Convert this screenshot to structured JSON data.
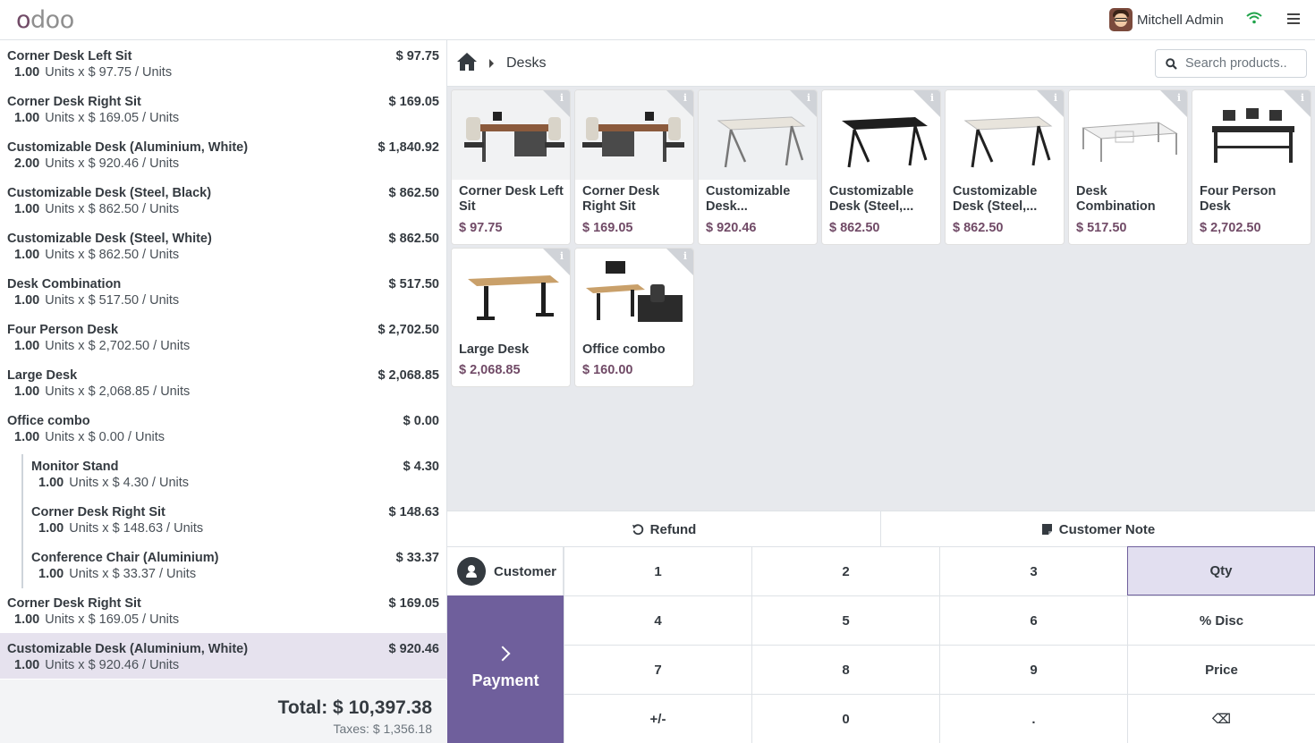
{
  "app": {
    "logo_text": "odoo"
  },
  "header": {
    "user_name": "Mitchell Admin",
    "wifi_icon": "wifi-icon",
    "menu_icon": "hamburger-menu-icon"
  },
  "order": {
    "lines": [
      {
        "name": "Corner Desk Left Sit",
        "price": "$ 97.75",
        "qty": "1.00",
        "detail": "Units x $ 97.75 / Units"
      },
      {
        "name": "Corner Desk Right Sit",
        "price": "$ 169.05",
        "qty": "1.00",
        "detail": "Units x $ 169.05 / Units"
      },
      {
        "name": "Customizable Desk (Aluminium, White)",
        "price": "$ 1,840.92",
        "qty": "2.00",
        "detail": "Units x $ 920.46 / Units"
      },
      {
        "name": "Customizable Desk (Steel, Black)",
        "price": "$ 862.50",
        "qty": "1.00",
        "detail": "Units x $ 862.50 / Units"
      },
      {
        "name": "Customizable Desk (Steel, White)",
        "price": "$ 862.50",
        "qty": "1.00",
        "detail": "Units x $ 862.50 / Units"
      },
      {
        "name": "Desk Combination",
        "price": "$ 517.50",
        "qty": "1.00",
        "detail": "Units x $ 517.50 / Units"
      },
      {
        "name": "Four Person Desk",
        "price": "$ 2,702.50",
        "qty": "1.00",
        "detail": "Units x $ 2,702.50 / Units"
      },
      {
        "name": "Large Desk",
        "price": "$ 2,068.85",
        "qty": "1.00",
        "detail": "Units x $ 2,068.85 / Units"
      },
      {
        "name": "Office combo",
        "price": "$ 0.00",
        "qty": "1.00",
        "detail": "Units x $ 0.00 / Units"
      },
      {
        "name": "Monitor Stand",
        "price": "$ 4.30",
        "qty": "1.00",
        "detail": "Units x $ 4.30 / Units"
      },
      {
        "name": "Corner Desk Right Sit",
        "price": "$ 148.63",
        "qty": "1.00",
        "detail": "Units x $ 148.63 / Units"
      },
      {
        "name": "Conference Chair (Aluminium)",
        "price": "$ 33.37",
        "qty": "1.00",
        "detail": "Units x $ 33.37 / Units"
      },
      {
        "name": "Corner Desk Right Sit",
        "price": "$ 169.05",
        "qty": "1.00",
        "detail": "Units x $ 169.05 / Units"
      },
      {
        "name": "Customizable Desk (Aluminium, White)",
        "price": "$ 920.46",
        "qty": "1.00",
        "detail": "Units x $ 920.46 / Units"
      }
    ],
    "total": "Total: $ 10,397.38",
    "taxes": "Taxes: $ 1,356.18"
  },
  "breadcrumb": {
    "category": "Desks"
  },
  "search": {
    "placeholder": "Search products.."
  },
  "products": [
    {
      "name": "Corner Desk Left Sit",
      "price": "$ 97.75"
    },
    {
      "name": "Corner Desk Right Sit",
      "price": "$ 169.05"
    },
    {
      "name": "Customizable Desk...",
      "price": "$ 920.46"
    },
    {
      "name": "Customizable Desk (Steel,...",
      "price": "$ 862.50"
    },
    {
      "name": "Customizable Desk (Steel,...",
      "price": "$ 862.50"
    },
    {
      "name": "Desk Combination",
      "price": "$ 517.50"
    },
    {
      "name": "Four Person Desk",
      "price": "$ 2,702.50"
    },
    {
      "name": "Large Desk",
      "price": "$ 2,068.85"
    },
    {
      "name": "Office combo",
      "price": "$ 160.00"
    }
  ],
  "controls": {
    "refund": "Refund",
    "customer_note": "Customer Note"
  },
  "actionpad": {
    "customer": "Customer",
    "payment": "Payment"
  },
  "numpad": {
    "keys": [
      "1",
      "2",
      "3",
      "Qty",
      "4",
      "5",
      "6",
      "% Disc",
      "7",
      "8",
      "9",
      "Price",
      "+/-",
      "0",
      ".",
      "⌫"
    ],
    "active_mode": "Qty"
  },
  "colors": {
    "brand": "#714b67",
    "payment": "#6f5f9c",
    "selected_line": "#e6e2ee"
  }
}
